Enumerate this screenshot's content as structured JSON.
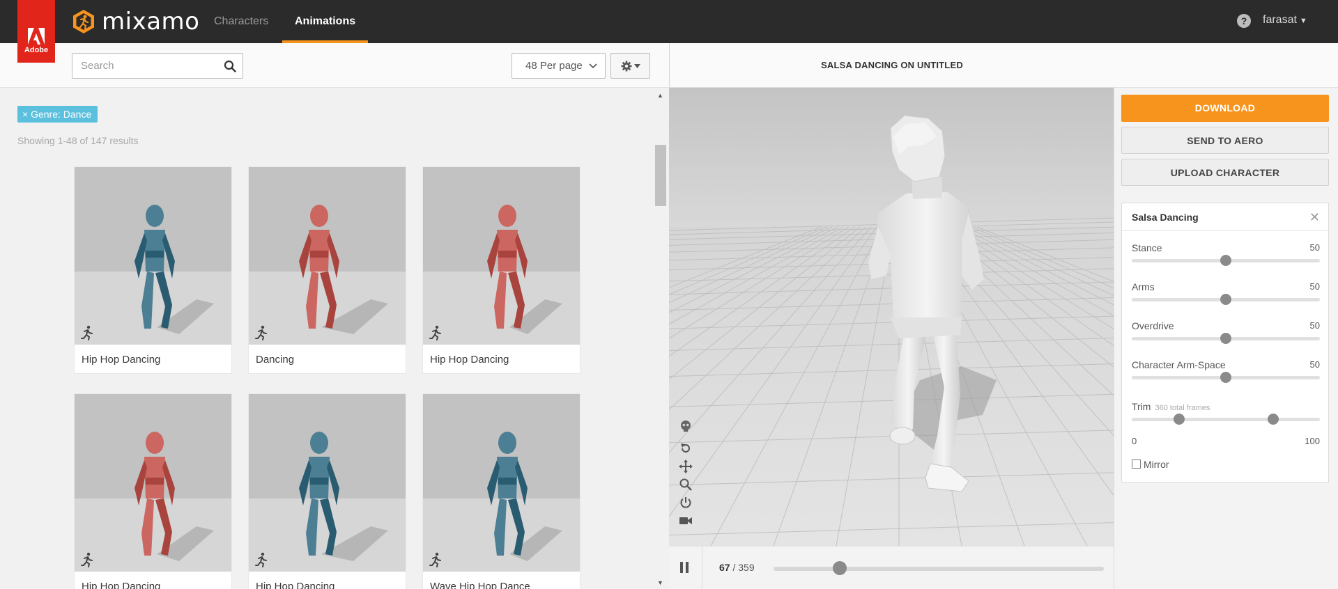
{
  "header": {
    "adobe_text": "Adobe",
    "brand": "mixamo",
    "nav": [
      {
        "label": "Characters",
        "active": false
      },
      {
        "label": "Animations",
        "active": true
      }
    ],
    "help_label": "?",
    "user": "farasat"
  },
  "search": {
    "placeholder": "Search",
    "value": ""
  },
  "per_page": "48 Per page",
  "filter": {
    "label": "× Genre: Dance"
  },
  "results_text": "Showing 1-48 of 147 results",
  "cards": [
    {
      "label": "Hip Hop Dancing",
      "color": "#4d7f94"
    },
    {
      "label": "Dancing",
      "color": "#cc6660"
    },
    {
      "label": "Hip Hop Dancing",
      "color": "#cc6660"
    },
    {
      "label": "Hip Hop Dancing",
      "color": "#cc6660"
    },
    {
      "label": "Hip Hop Dancing",
      "color": "#4d7f94"
    },
    {
      "label": "Wave Hip Hop Dance",
      "color": "#4d7f94"
    }
  ],
  "viewer": {
    "title": "SALSA DANCING ON UNTITLED",
    "frame_current": "67",
    "frame_total": "/ 359",
    "progress": 0.2
  },
  "actions": {
    "download": "DOWNLOAD",
    "send_to_aero": "SEND TO AERO",
    "upload_character": "UPLOAD CHARACTER"
  },
  "settings": {
    "title": "Salsa Dancing",
    "close_label": "✕",
    "params": [
      {
        "label": "Stance",
        "value": "50",
        "fraction": 0.5
      },
      {
        "label": "Arms",
        "value": "50",
        "fraction": 0.5
      },
      {
        "label": "Overdrive",
        "value": "50",
        "fraction": 0.5
      },
      {
        "label": "Character Arm-Space",
        "value": "50",
        "fraction": 0.5
      }
    ],
    "trim": {
      "label": "Trim",
      "sub": "360 total frames",
      "start": 0.25,
      "end": 0.75,
      "min_label": "0",
      "max_label": "100"
    },
    "mirror": {
      "label": "Mirror",
      "checked": false
    }
  },
  "colors": {
    "accent": "#f7941d",
    "topbar": "#2b2b2b",
    "adobe_red": "#e1251b",
    "filter_tag": "#5bc0de"
  }
}
